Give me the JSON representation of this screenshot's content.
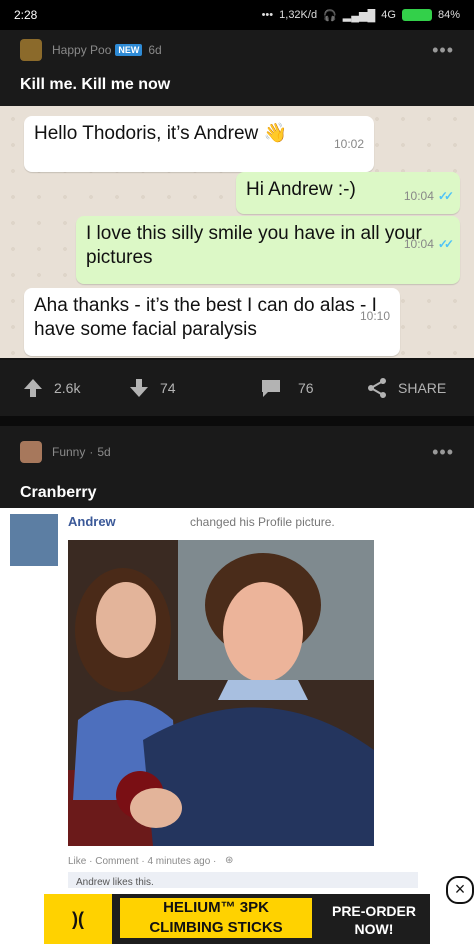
{
  "status": {
    "time": "2:28",
    "speed": "1,32K/d",
    "network": "4G",
    "battery": "84%"
  },
  "post1": {
    "author": "Happy Poo",
    "badge": "NEW",
    "age": "6d",
    "title": "Kill me. Kill me now",
    "chat": [
      {
        "text": "Hello Thodoris, it’s Andrew",
        "emoji": "👋",
        "time": "10:02",
        "dir": "in"
      },
      {
        "text": "Hi Andrew :-)",
        "time": "10:04",
        "dir": "out"
      },
      {
        "text": "I love this silly smile you have in all your pictures",
        "time": "10:04",
        "dir": "out"
      },
      {
        "text": "Aha thanks - it’s the best I can do alas - I have some facial paralysis",
        "time": "10:10",
        "dir": "in"
      }
    ],
    "upvotes": "2.6k",
    "downvotes": "74",
    "comments": "76",
    "share": "SHARE"
  },
  "post2": {
    "author": "Funny",
    "age": "5d",
    "title": "Cranberry",
    "fb_name": "Andrew",
    "fb_action": "changed his Profile picture.",
    "fb_meta": "Like · Comment · 4 minutes ago ·",
    "fb_like_line": "Andrew likes this."
  },
  "ad": {
    "brand": "HELIUM™ 3PK",
    "sub": "CLIMBING STICKS",
    "cta": "PRE-ORDER NOW!",
    "close": "×"
  }
}
